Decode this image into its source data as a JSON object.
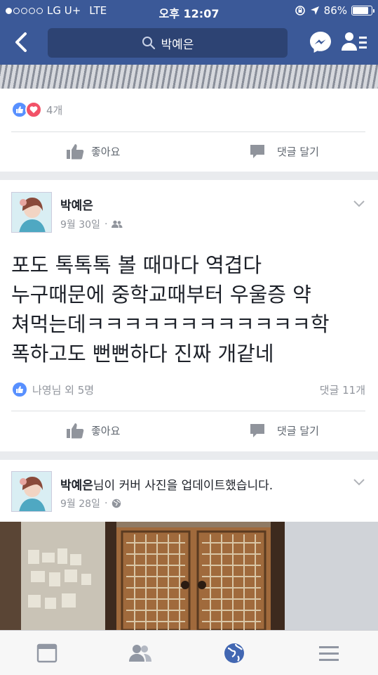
{
  "status_bar": {
    "carrier": "LG U+",
    "network": "LTE",
    "time": "오후 12:07",
    "battery": "86%",
    "battery_level": 0.86
  },
  "nav": {
    "search_text": "박예은",
    "icons": [
      "back-icon",
      "search-icon",
      "messenger-icon",
      "friends-list-icon"
    ]
  },
  "previous_post": {
    "reaction_count": "4개",
    "like_label": "좋아요",
    "comment_label": "댓글 달기"
  },
  "post": {
    "author": "박예은",
    "date": "9월 30일",
    "text_lines": [
      "포도 톡톡톡 볼 때마다 역겹다",
      "누구때문에 중학교때부터 우울증 약",
      "쳐먹는데ㅋㅋㅋㅋㅋㅋㅋㅋㅋㅋㅋㅋ학",
      "폭하고도 뻔뻔하다 진짜 개같네"
    ],
    "reactions_text": "나영님 외 5명",
    "comments_text": "댓글 11개",
    "like_label": "좋아요",
    "comment_label": "댓글 달기"
  },
  "cover_post": {
    "author": "박예은",
    "action_text": "님이 커버 사진을 업데이트했습니다.",
    "date": "9월 28일"
  },
  "tabbar": {
    "tabs": [
      "news-feed-icon",
      "friends-icon",
      "globe-icon",
      "menu-icon"
    ],
    "active_tab": "globe-icon"
  },
  "colors": {
    "brand": "#3b5998",
    "like_blue": "#5890ff",
    "love_red": "#f25268"
  }
}
